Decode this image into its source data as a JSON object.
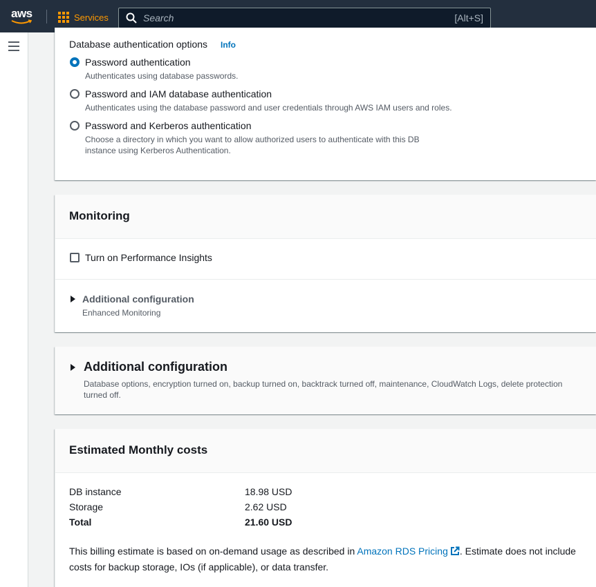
{
  "nav": {
    "logo_text": "aws",
    "services_label": "Services",
    "search_placeholder": "Search",
    "search_shortcut": "[Alt+S]"
  },
  "auth": {
    "section_label": "Database authentication options",
    "info_label": "Info",
    "options": [
      {
        "label": "Password authentication",
        "desc": "Authenticates using database passwords.",
        "checked": true
      },
      {
        "label": "Password and IAM database authentication",
        "desc": "Authenticates using the database password and user credentials through AWS IAM users and roles.",
        "checked": false
      },
      {
        "label": "Password and Kerberos authentication",
        "desc_line1": "Choose a directory in which you want to allow authorized users to authenticate with this DB",
        "desc_line2": "instance using Kerberos Authentication.",
        "checked": false
      }
    ]
  },
  "monitoring": {
    "title": "Monitoring",
    "performance_insights_label": "Turn on Performance Insights",
    "additional_config_title": "Additional configuration",
    "additional_config_desc": "Enhanced Monitoring"
  },
  "additional_configuration": {
    "title": "Additional configuration",
    "desc_line1": "Database options, encryption turned on, backup turned on, backtrack turned off, maintenance, CloudWatch Logs, delete protection",
    "desc_line2": "turned off."
  },
  "costs": {
    "title": "Estimated Monthly costs",
    "rows": [
      {
        "label": "DB instance",
        "value": "18.98 USD"
      },
      {
        "label": "Storage",
        "value": "2.62 USD"
      },
      {
        "label": "Total",
        "value": "21.60 USD"
      }
    ],
    "billing_prefix": "This billing estimate is based on on-demand usage as described in ",
    "billing_link": "Amazon RDS Pricing",
    "billing_suffix_line1": ". Estimate does not include",
    "billing_suffix_line2": "costs for backup storage, IOs (if applicable), or data transfer."
  },
  "colors": {
    "nav_bg": "#232f3e",
    "services_orange": "#ff9900",
    "link_blue": "#0073bb",
    "radio_blue": "#0073bb"
  }
}
